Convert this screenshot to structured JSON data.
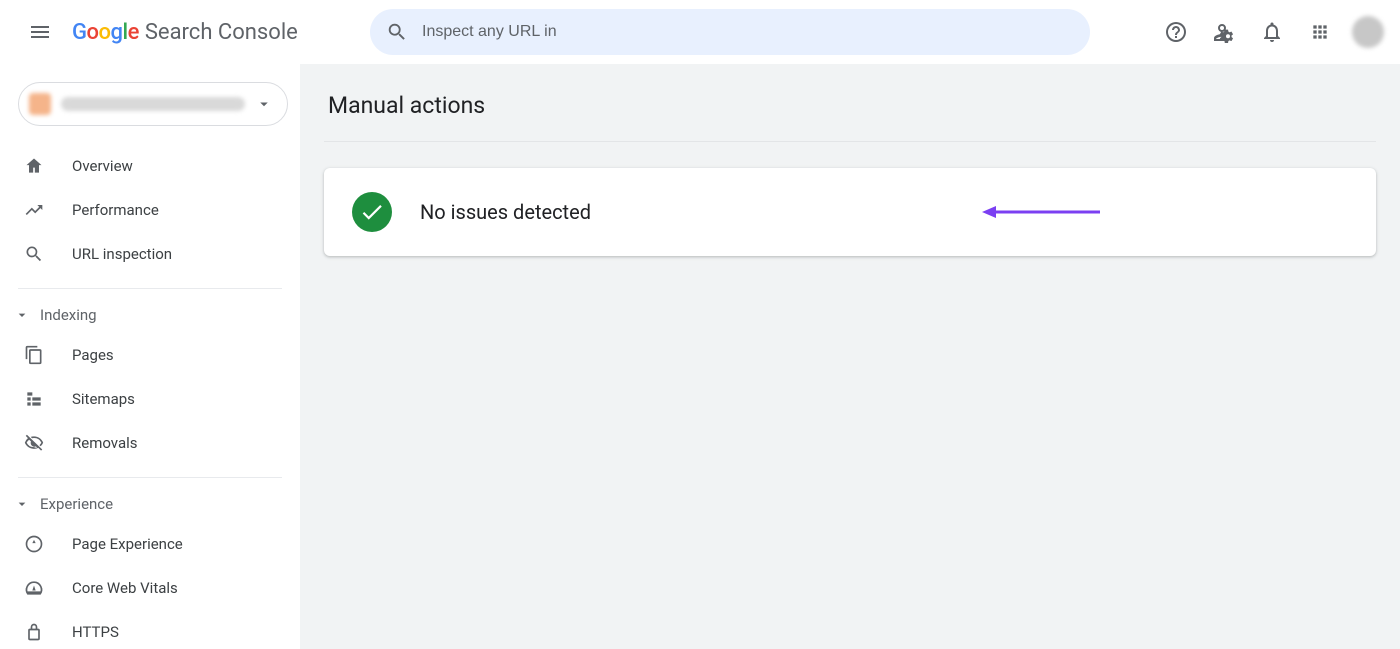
{
  "header": {
    "logo_suffix": "Search Console",
    "search_placeholder": "Inspect any URL in "
  },
  "sidebar": {
    "items": [
      {
        "icon": "home",
        "label": "Overview"
      },
      {
        "icon": "trend",
        "label": "Performance"
      },
      {
        "icon": "search",
        "label": "URL inspection"
      }
    ],
    "group_indexing": "Indexing",
    "indexing_items": [
      {
        "icon": "pages",
        "label": "Pages"
      },
      {
        "icon": "sitemap",
        "label": "Sitemaps"
      },
      {
        "icon": "removals",
        "label": "Removals"
      }
    ],
    "group_experience": "Experience",
    "experience_items": [
      {
        "icon": "pagex",
        "label": "Page Experience"
      },
      {
        "icon": "vitals",
        "label": "Core Web Vitals"
      },
      {
        "icon": "https",
        "label": "HTTPS"
      }
    ]
  },
  "main": {
    "title": "Manual actions",
    "status_message": "No issues detected"
  }
}
